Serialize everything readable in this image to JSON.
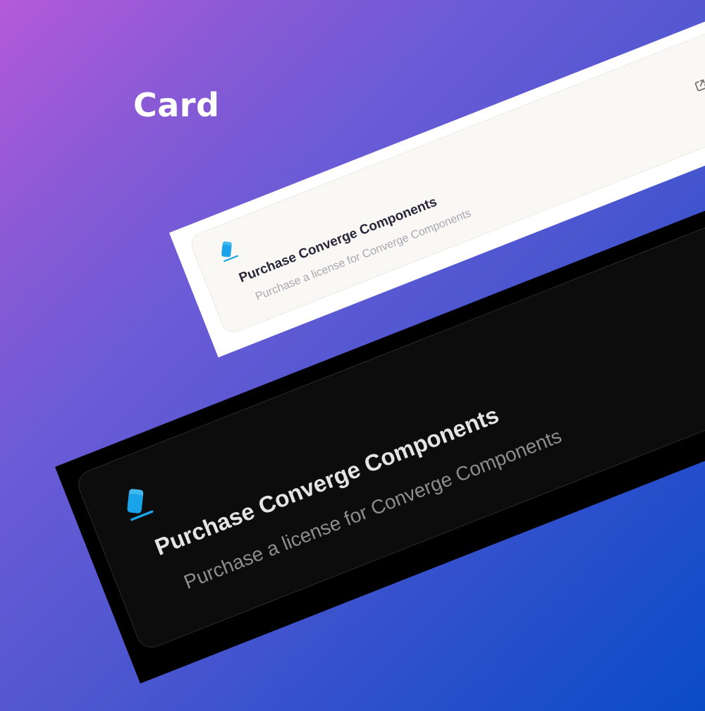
{
  "page": {
    "heading": "Card"
  },
  "light_card": {
    "title": "Purchase Converge Components",
    "description": "Purchase a license for Converge Components",
    "logo_icon": "converge-logo-icon",
    "action_icon": "external-link-icon",
    "colors": {
      "frame": "#ffffff",
      "card": "#faf8f5",
      "title": "#2a2438",
      "description": "#a7a7b0"
    }
  },
  "dark_card": {
    "title": "Purchase Converge Components",
    "description": "Purchase a license for Converge Components",
    "logo_icon": "converge-logo-icon",
    "colors": {
      "frame": "#000000",
      "card": "#0c0c0c",
      "title": "#e4e4e4",
      "description": "#8d8d8d"
    }
  },
  "colors": {
    "background_start": "#b45ad9",
    "background_end": "#0a4cc6",
    "accent": "#1aa3e8"
  }
}
